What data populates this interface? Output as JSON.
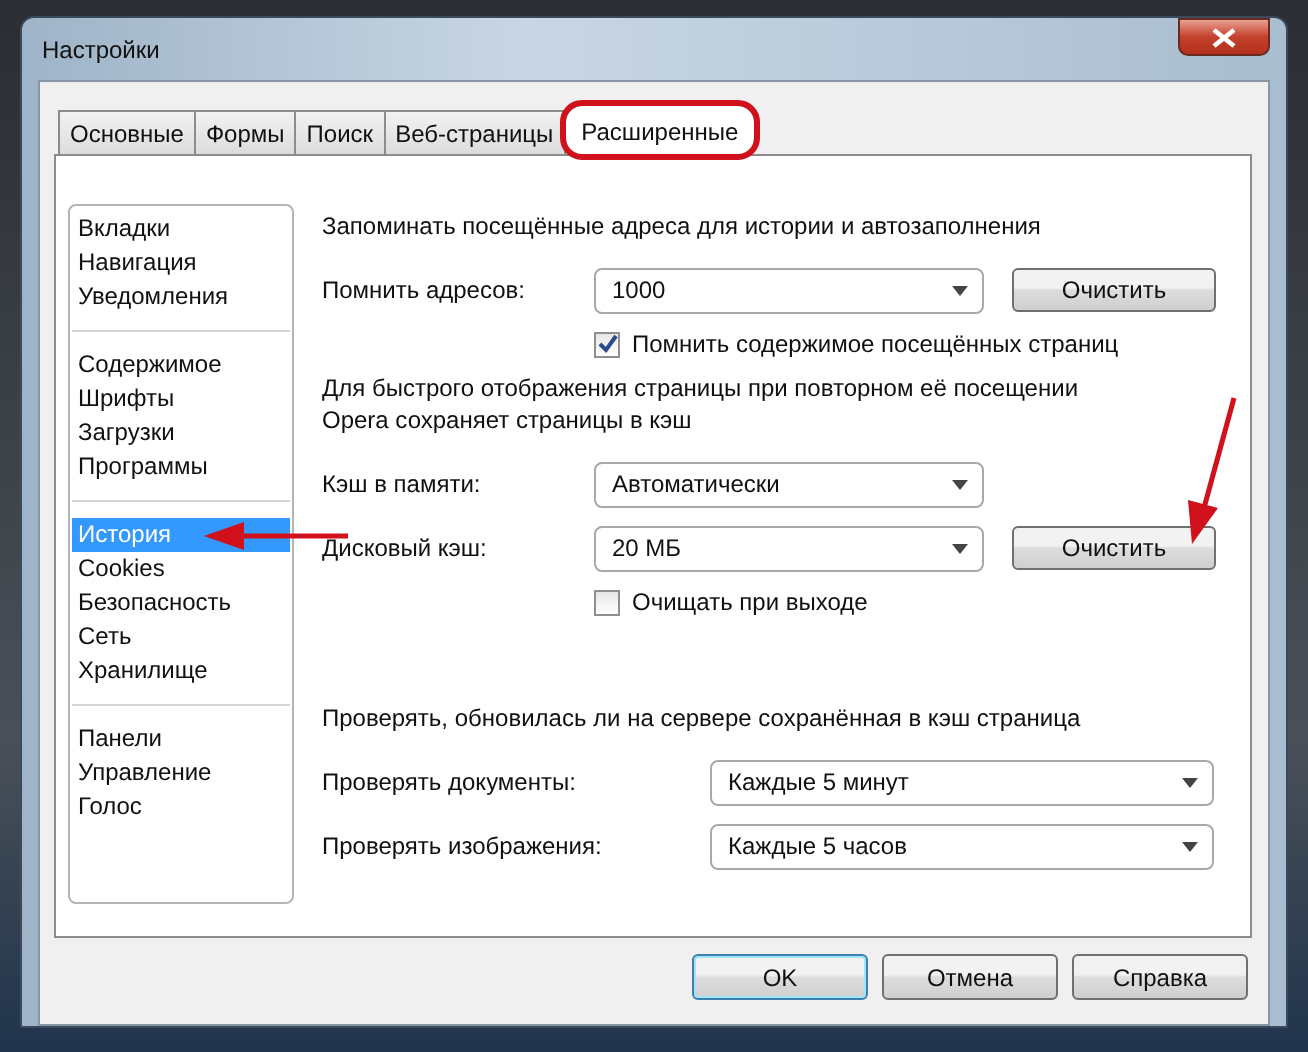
{
  "window": {
    "title": "Настройки"
  },
  "tabs": [
    {
      "label": "Основные",
      "selected": false,
      "circled": false
    },
    {
      "label": "Формы",
      "selected": false,
      "circled": false
    },
    {
      "label": "Поиск",
      "selected": false,
      "circled": false
    },
    {
      "label": "Веб-страницы",
      "selected": false,
      "circled": false
    },
    {
      "label": "Расширенные",
      "selected": true,
      "circled": true
    }
  ],
  "sidebar": {
    "groups": [
      {
        "items": [
          {
            "label": "Вкладки",
            "selected": false,
            "arrow": false
          },
          {
            "label": "Навигация",
            "selected": false,
            "arrow": false
          },
          {
            "label": "Уведомления",
            "selected": false,
            "arrow": false
          }
        ]
      },
      {
        "items": [
          {
            "label": "Содержимое",
            "selected": false,
            "arrow": false
          },
          {
            "label": "Шрифты",
            "selected": false,
            "arrow": false
          },
          {
            "label": "Загрузки",
            "selected": false,
            "arrow": false
          },
          {
            "label": "Программы",
            "selected": false,
            "arrow": false
          }
        ]
      },
      {
        "items": [
          {
            "label": "История",
            "selected": true,
            "arrow": true
          },
          {
            "label": "Cookies",
            "selected": false,
            "arrow": false
          },
          {
            "label": "Безопасность",
            "selected": false,
            "arrow": false
          },
          {
            "label": "Сеть",
            "selected": false,
            "arrow": false
          },
          {
            "label": "Хранилище",
            "selected": false,
            "arrow": false
          }
        ]
      },
      {
        "items": [
          {
            "label": "Панели",
            "selected": false,
            "arrow": false
          },
          {
            "label": "Управление",
            "selected": false,
            "arrow": false
          },
          {
            "label": "Голос",
            "selected": false,
            "arrow": false
          }
        ]
      }
    ]
  },
  "history": [
    {
      "kind": "heading",
      "text": "Запоминать посещённые адреса для истории и автозаполнения"
    },
    {
      "kind": "combo",
      "label": "Помнить адресов:",
      "value": "1000",
      "button": "Очистить"
    },
    {
      "kind": "checkbox",
      "label": "Помнить содержимое посещённых страниц",
      "checked": true
    },
    {
      "kind": "heading",
      "text": "Для быстрого отображения страницы при повторном её посещении\nOpera сохраняет страницы в кэш"
    },
    {
      "kind": "combo",
      "label": "Кэш в памяти:",
      "value": "Автоматически"
    },
    {
      "kind": "combo",
      "label": "Дисковый кэш:",
      "value": "20 МБ",
      "button": "Очистить",
      "arrow": true
    },
    {
      "kind": "checkbox",
      "label": "Очищать при выходе",
      "checked": false
    }
  ],
  "check": [
    {
      "kind": "heading",
      "text": "Проверять, обновилась ли на сервере сохранённая в кэш страница"
    },
    {
      "kind": "wide_combo",
      "label": "Проверять документы:",
      "value": "Каждые 5 минут"
    },
    {
      "kind": "wide_combo",
      "label": "Проверять изображения:",
      "value": "Каждые 5 часов"
    }
  ],
  "buttons": [
    {
      "label": "OK",
      "default": true
    },
    {
      "label": "Отмена",
      "default": false
    },
    {
      "label": "Справка",
      "default": false
    }
  ]
}
